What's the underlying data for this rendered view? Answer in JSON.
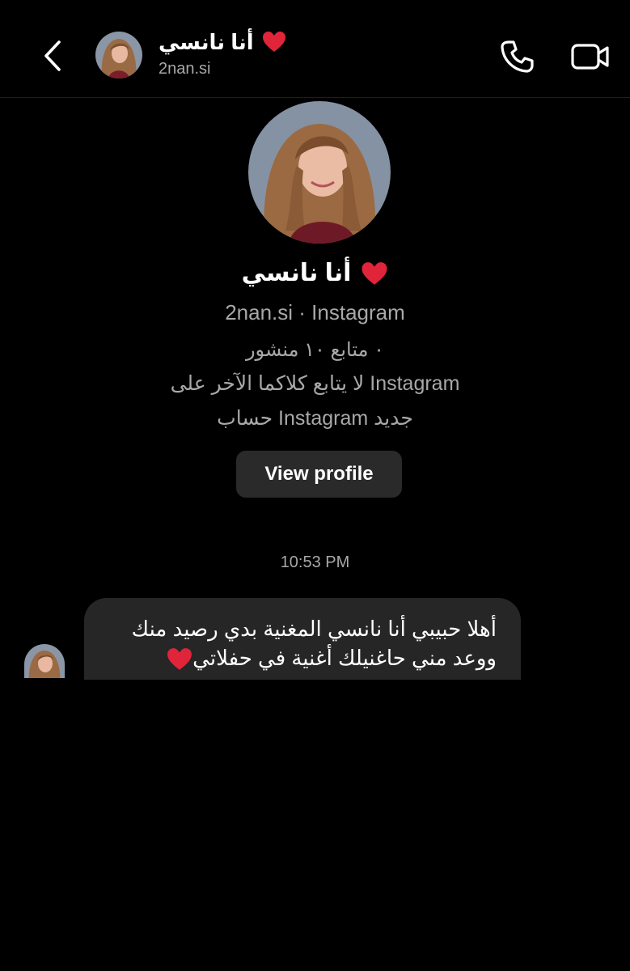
{
  "header": {
    "name": "أنا نانسي",
    "handle": "2nan.si",
    "icons": {
      "back": "chevron-left-icon",
      "call": "phone-icon",
      "video": "video-camera-icon",
      "heart": "red-heart-icon"
    }
  },
  "profile": {
    "name": "أنا نانسي",
    "subtitle": "2nan.si · Instagram",
    "stats": "٠ متابع ١٠ منشور",
    "mutual": "لا يتابع كلاكما الآخر على Instagram",
    "new_account": "حساب Instagram جديد",
    "view_profile_label": "View profile"
  },
  "conversation": {
    "timestamp": "10:53 PM",
    "message_line1": "أهلا حبيبي أنا نانسي المغنية بدي رصيد منك",
    "message_line2": "ووعد مني حاغنيلك أغنية في حفلاتي"
  },
  "colors": {
    "background": "#000000",
    "secondary_text": "#a8a8a8",
    "bubble": "#262626",
    "button": "#2a2a2a",
    "heart": "#e0243a"
  }
}
